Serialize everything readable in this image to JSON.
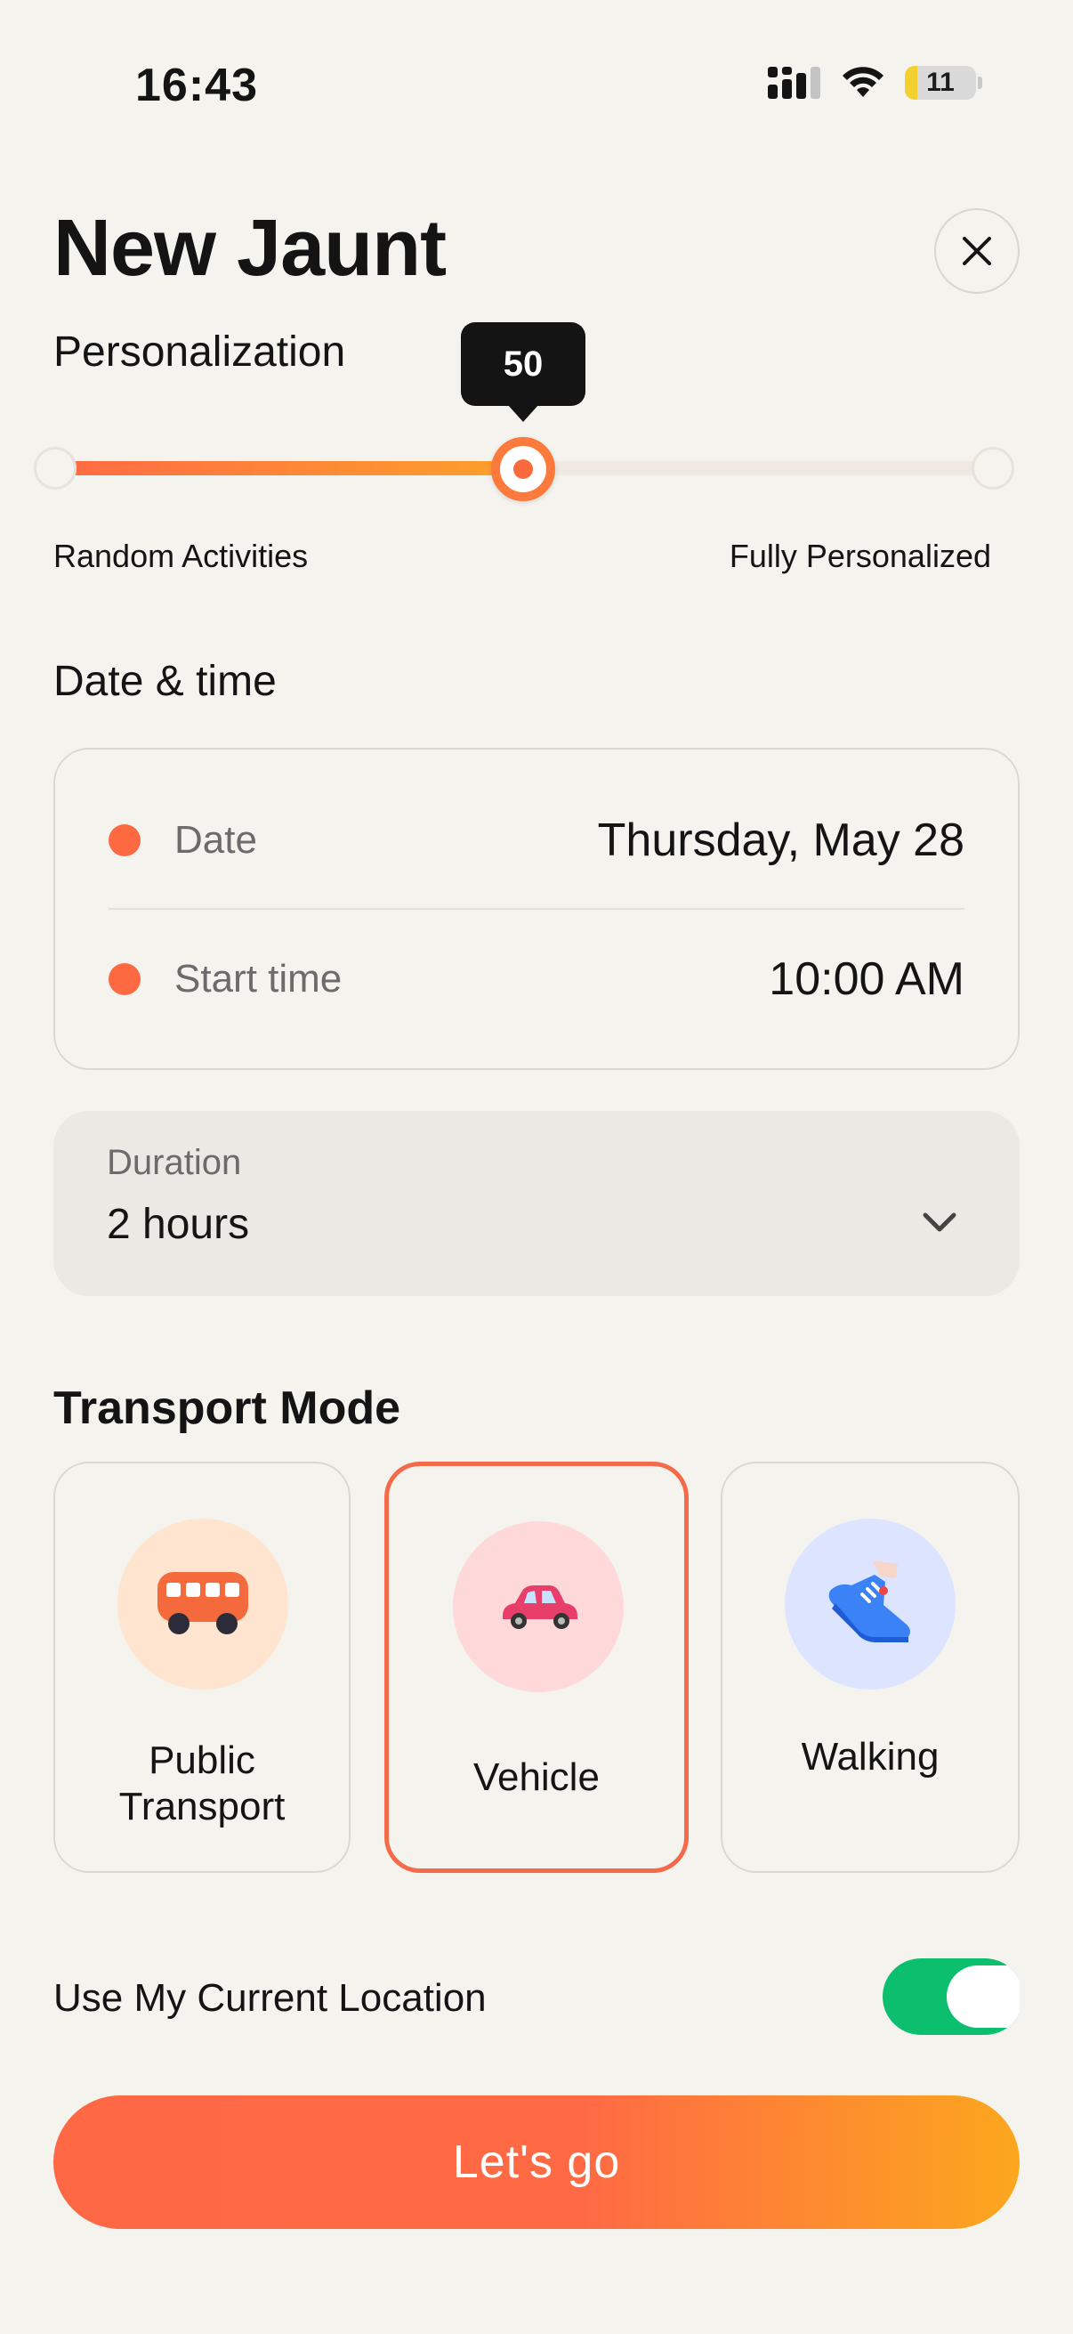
{
  "status_bar": {
    "time": "16:43",
    "battery_level": "11",
    "icons": [
      "cellular-signal-icon",
      "wifi-icon",
      "battery-icon"
    ]
  },
  "header": {
    "title": "New Jaunt",
    "close_icon": "close-icon"
  },
  "personalization": {
    "label": "Personalization",
    "value": 50,
    "value_text": "50",
    "min": 0,
    "max": 100,
    "min_label": "Random Activities",
    "max_label": "Fully Personalized"
  },
  "date_time": {
    "label": "Date & time",
    "date_label": "Date",
    "date_value": "Thursday, May 28",
    "start_label": "Start time",
    "start_value": "10:00 AM"
  },
  "duration": {
    "label": "Duration",
    "value": "2 hours",
    "chevron_icon": "chevron-down-icon"
  },
  "transport": {
    "title": "Transport Mode",
    "selected": "Vehicle",
    "options": [
      {
        "label": "Public\nTransport",
        "icon": "bus-icon",
        "circle_color": "#ffe4d0"
      },
      {
        "label": "Vehicle",
        "icon": "car-icon",
        "circle_color": "#ffd9d9"
      },
      {
        "label": "Walking",
        "icon": "sneaker-icon",
        "circle_color": "#dde4ff"
      }
    ]
  },
  "location": {
    "label": "Use My Current Location",
    "enabled": true
  },
  "cta": {
    "label": "Let's go"
  },
  "colors": {
    "accent": "#fd6a42",
    "accent_end": "#fca71e",
    "toggle_on": "#0bbf6e",
    "background": "#f4f3ee"
  }
}
